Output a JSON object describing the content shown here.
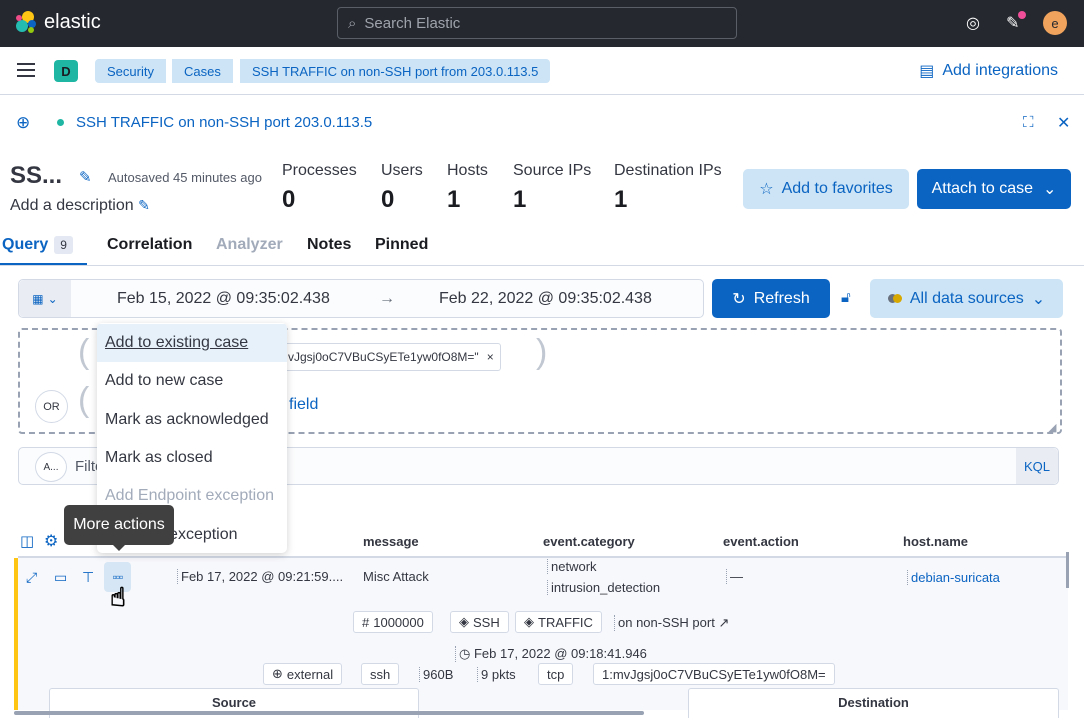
{
  "header": {
    "brand": "elastic",
    "search_placeholder": "Search Elastic",
    "user_initial": "e"
  },
  "nav": {
    "space_initial": "D",
    "breadcrumbs": [
      "Security",
      "Cases",
      "SSH TRAFFIC on non-SSH port from 203.0.113.5"
    ],
    "add_integrations": "Add integrations"
  },
  "timeline": {
    "title": "SSH TRAFFIC on non-SSH port 203.0.113.5",
    "name": "SS...",
    "autosaved": "Autosaved 45 minutes ago",
    "description": "Add a description",
    "stats": [
      {
        "label": "Processes",
        "value": "0"
      },
      {
        "label": "Users",
        "value": "0"
      },
      {
        "label": "Hosts",
        "value": "1"
      },
      {
        "label": "Source IPs",
        "value": "1"
      },
      {
        "label": "Destination IPs",
        "value": "1"
      }
    ],
    "add_to_favorites": "Add to favorites",
    "attach_to_case": "Attach to case"
  },
  "tabs": [
    {
      "label": "Query",
      "badge": "9",
      "state": "active"
    },
    {
      "label": "Correlation",
      "state": "normal"
    },
    {
      "label": "Analyzer",
      "state": "disabled"
    },
    {
      "label": "Notes",
      "state": "normal"
    },
    {
      "label": "Pinned",
      "state": "normal"
    }
  ],
  "datepicker": {
    "start": "Feb 15, 2022 @ 09:35:02.438",
    "arrow": "→",
    "end": "Feb 22, 2022 @ 09:35:02.438",
    "refresh": "Refresh",
    "data_sources": "All data sources"
  },
  "query_builder": {
    "provider_value": "vJgsj0oC7VBuCSyETe1yw0fO8M=\"",
    "or_label": "OR",
    "field_link": "field"
  },
  "filter": {
    "and_label": "A...",
    "placeholder": "Filter",
    "kql": "KQL"
  },
  "table": {
    "columns": [
      "message",
      "event.category",
      "event.action",
      "host.name"
    ],
    "row": {
      "timestamp": "Feb 17, 2022 @ 09:21:59....",
      "message": "Misc Attack",
      "event_category": [
        "network",
        "intrusion_detection"
      ],
      "event_action": "—",
      "host_name": "debian-suricata",
      "rule_id": "1000000",
      "tags": [
        "SSH",
        "TRAFFIC"
      ],
      "rule_link": "on non-SSH port",
      "event_time": "Feb 17, 2022 @ 09:18:41.946",
      "network_direction": "external",
      "protocol": "ssh",
      "bytes": "960B",
      "packets": "9 pkts",
      "transport": "tcp",
      "community_id": "1:mvJgsj0oC7VBuCSyETe1yw0fO8M=",
      "source_label": "Source",
      "destination_label": "Destination"
    }
  },
  "actions_menu": {
    "items": [
      {
        "label": "Add to existing case",
        "state": "hover"
      },
      {
        "label": "Add to new case",
        "state": "normal"
      },
      {
        "label": "Mark as acknowledged",
        "state": "normal"
      },
      {
        "label": "Mark as closed",
        "state": "normal"
      },
      {
        "label": "Add Endpoint exception",
        "state": "disabled"
      },
      {
        "label": "Add rule exception",
        "state": "normal"
      }
    ]
  },
  "tooltip": "More actions",
  "colors": {
    "accent": "#0b64c2",
    "header_bg": "#25282f",
    "alert_bar": "#fec514",
    "space_badge": "#1fb7a4"
  }
}
